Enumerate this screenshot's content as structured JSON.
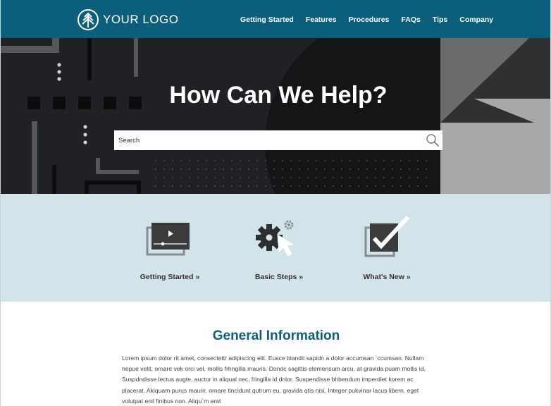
{
  "header": {
    "logo_text": "YOUR LOGO",
    "nav": [
      "Getting Started",
      "Features",
      "Procedures",
      "FAQs",
      "Tips",
      "Company"
    ]
  },
  "hero": {
    "title": "How Can We Help?",
    "search_placeholder": "Search"
  },
  "features": [
    {
      "label": "Getting Started »",
      "icon": "video-player-icon"
    },
    {
      "label": "Basic Steps »",
      "icon": "gear-cursor-icon"
    },
    {
      "label": "What's New »",
      "icon": "checkbox-icon"
    }
  ],
  "info": {
    "title": "General Information",
    "body": "Lorem ipsum dolor rit amet, consectettr adipiscing elit. Eusce blandit sapidn a dolor accumsan `ccumsan. Nullam nepue velit, ornare vek orci vel, mollis frhngilla mauris. Dondc sagittis elemensum arcu, at gravida puam mollis id. Suspdndisse lectus augte, auctor in aliqual nec, fringilla id dnlor. Suspendisse bhbendum imperdiet korem ac placerat. Akiquam purus maurir, ornare tincidunt qutrum eu, gravida qtis nisi. Integer pukvinar lacus libern, eget volutpat enil finibus non. Aliqu`m erat"
  },
  "colors": {
    "brand": "#0b5e7c",
    "hero_bg": "#202124",
    "features_bg": "#d2e3ea",
    "heading": "#0b5e7c"
  }
}
